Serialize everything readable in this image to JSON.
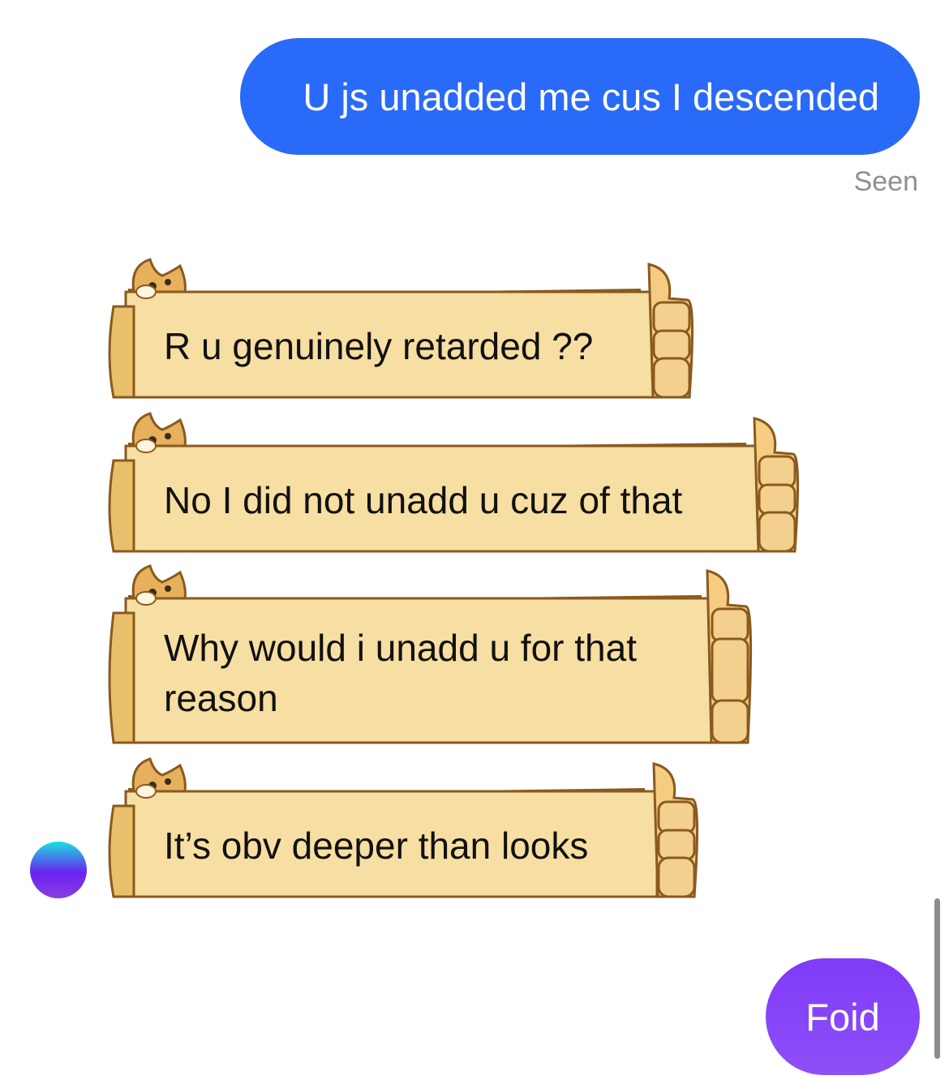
{
  "messages": {
    "sent_1": "U js unadded me cus I descended",
    "status": "Seen",
    "received": [
      "R u genuinely retarded ??",
      "No I did not unadd u cuz of that",
      "Why would i unadd u for that reason",
      "It’s obv deeper than looks"
    ],
    "sent_2": "Foid"
  },
  "colors": {
    "sent_bubble": "#2a6af8",
    "sent_bubble_2": "#8b4af8",
    "doge_paper": "#f7dea2",
    "doge_outline": "#8a5a1e"
  },
  "icons": {
    "doge": "doge-icon",
    "thumb": "thumbs-up-paw-icon"
  }
}
